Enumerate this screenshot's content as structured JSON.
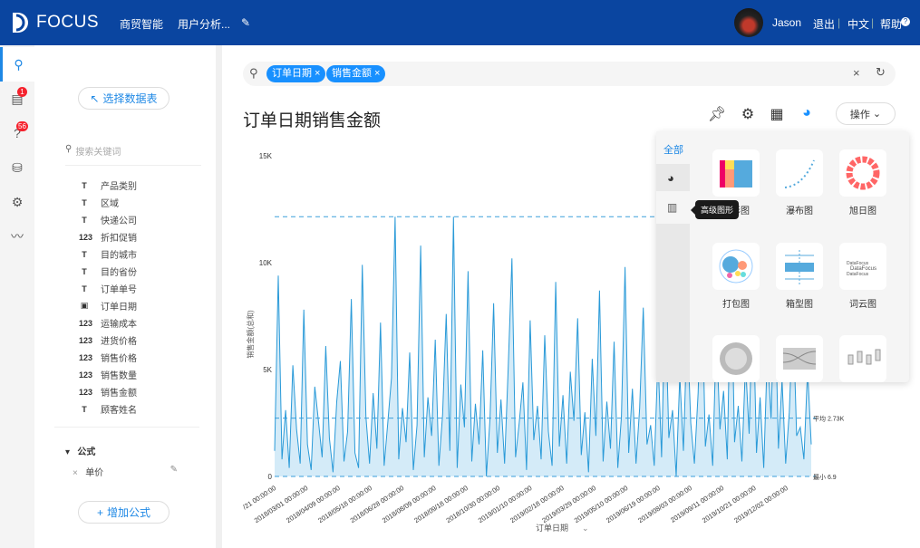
{
  "header": {
    "brand": "FOCUS",
    "nav": [
      "商贸智能",
      "用户分析..."
    ],
    "user": "Jason",
    "logout": "退出",
    "lang": "中文",
    "help": "帮助"
  },
  "sidebar_icons": [
    {
      "name": "search-icon"
    },
    {
      "name": "dashboard-icon",
      "badge": "1"
    },
    {
      "name": "question-icon",
      "badge": "56"
    },
    {
      "name": "database-icon"
    },
    {
      "name": "settings-icon"
    },
    {
      "name": "trend-icon"
    }
  ],
  "left_panel": {
    "select_table": "选择数据表",
    "search_placeholder": "搜索关键词",
    "fields": [
      {
        "type": "text",
        "label": "产品类别"
      },
      {
        "type": "text",
        "label": "区域"
      },
      {
        "type": "text",
        "label": "快递公司"
      },
      {
        "type": "number",
        "label": "折扣促销"
      },
      {
        "type": "text",
        "label": "目的城市"
      },
      {
        "type": "text",
        "label": "目的省份"
      },
      {
        "type": "text",
        "label": "订单单号"
      },
      {
        "type": "date",
        "label": "订单日期"
      },
      {
        "type": "number",
        "label": "运输成本"
      },
      {
        "type": "number",
        "label": "进货价格"
      },
      {
        "type": "number",
        "label": "销售价格"
      },
      {
        "type": "number",
        "label": "销售数量"
      },
      {
        "type": "number",
        "label": "销售金额"
      },
      {
        "type": "text",
        "label": "顾客姓名"
      }
    ],
    "formula_section": "公式",
    "formulas": [
      "单价"
    ],
    "add_formula": "增加公式"
  },
  "search": {
    "tokens": [
      "订单日期",
      "销售金额"
    ]
  },
  "main": {
    "title": "订单日期销售金额",
    "action_button": "操作"
  },
  "popup": {
    "tabs": [
      "全部"
    ],
    "tooltip": "高级图形",
    "charts": [
      "矩形图",
      "瀑布图",
      "旭日图",
      "打包图",
      "箱型图",
      "词云图",
      "",
      "",
      ""
    ]
  },
  "chart_data": {
    "type": "area",
    "ylabel": "销售金额(总和)",
    "xlabel": "订单日期",
    "ylim": [
      0,
      15000
    ],
    "yticks": [
      "0",
      "5K",
      "10K",
      "15K"
    ],
    "xticks": [
      "/21 00:00:00",
      "2018/03/01 00:00:00",
      "2018/04/09 00:00:00",
      "2018/05/18 00:00:00",
      "2018/06/28 00:00:00",
      "2018/08/09 00:00:00",
      "2018/09/18 00:00:00",
      "2018/10/30 00:00:00",
      "2019/01/10 00:00:00",
      "2019/02/18 00:00:00",
      "2019/03/29 00:00:00",
      "2019/05/10 00:00:00",
      "2019/06/19 00:00:00",
      "2019/08/03 00:00:00",
      "2019/09/11 00:00:00",
      "2019/10/21 00:00:00",
      "2019/12/02 00:00:00"
    ],
    "avg_label": "平均 2.73K",
    "min_label": "最小 6.9",
    "avg": 2730,
    "max": 12150,
    "min": 6.9,
    "values": [
      1200,
      9400,
      800,
      3100,
      400,
      5200,
      2200,
      600,
      7800,
      1500,
      300,
      4200,
      2600,
      900,
      6100,
      1800,
      200,
      3500,
      5400,
      700,
      2100,
      8300,
      1100,
      400,
      9900,
      2800,
      600,
      3900,
      1300,
      7200,
      500,
      2500,
      4600,
      12150,
      800,
      3200,
      1600,
      5800,
      300,
      2400,
      10800,
      900,
      3700,
      1900,
      6400,
      500,
      2900,
      7600,
      1200,
      12150,
      400,
      4300,
      2300,
      9600,
      700,
      3400,
      1500,
      5900,
      6.9,
      2700,
      8100,
      1100,
      3600,
      600,
      5100,
      10200,
      900,
      2500,
      4400,
      300,
      7300,
      1700,
      3300,
      800,
      6600,
      2100,
      500,
      9100,
      1400,
      3800,
      600,
      4900,
      2600,
      7400,
      1000,
      3000,
      200,
      5500,
      1900,
      8700,
      700,
      3500,
      1300,
      6300,
      400,
      2800,
      9800,
      1100,
      4100,
      600,
      3200,
      7900,
      1500,
      2400,
      500,
      5600,
      900,
      8400,
      1800,
      3100,
      6.9,
      4700,
      1200,
      7100,
      2500,
      600,
      3900,
      9300,
      1400,
      2900,
      500,
      6800,
      2200,
      4000,
      800,
      10400,
      1600,
      3300,
      700,
      5300,
      2000,
      8600,
      1100,
      3700,
      400,
      6000,
      2700,
      9000,
      1300,
      4500,
      600,
      3000,
      7700,
      1900,
      2300,
      800,
      5000,
      1500
    ]
  }
}
